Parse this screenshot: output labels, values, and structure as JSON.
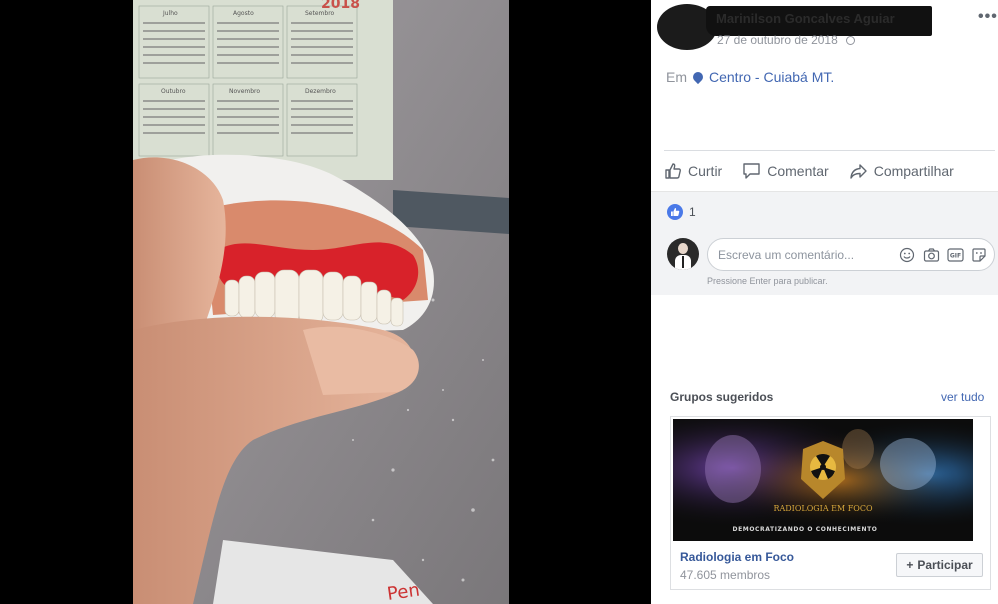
{
  "post": {
    "author": "Marinilson Goncalves Aguiar",
    "date": "27 de outubro de 2018",
    "location_prefix": "Em",
    "location_name": "Centro - Cuiabá MT.",
    "more_label": "•••"
  },
  "photo": {
    "calendar_year": "2018",
    "months": [
      "Julho",
      "Agosto",
      "Setembro",
      "Outubro",
      "Novembro",
      "Dezembro"
    ]
  },
  "actions": {
    "like": "Curtir",
    "comment": "Comentar",
    "share": "Compartilhar"
  },
  "feedback": {
    "like_count": "1",
    "comment_placeholder": "Escreva um comentário...",
    "enter_hint": "Pressione Enter para publicar.",
    "gif_label": "GIF"
  },
  "suggested": {
    "title": "Grupos sugeridos",
    "see_all": "ver tudo",
    "group": {
      "name": "Radiologia em Foco",
      "members": "47.605 membros",
      "join_label": "Participar",
      "banner_text": "DEMOCRATIZANDO O CONHECIMENTO",
      "logo_text": "RADIOLOGIA EM FOCO"
    }
  },
  "colors": {
    "link": "#4267b2",
    "muted": "#90949c",
    "feedback_bg": "#f2f3f5",
    "like_blue": "#4a79e8"
  }
}
